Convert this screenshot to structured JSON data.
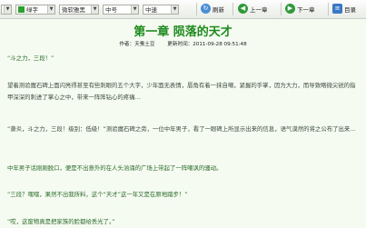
{
  "toolbar": {
    "color_label": "绿字",
    "color_hex": "#2ea02e",
    "font_label": "微软雅黑",
    "size_label": "中号",
    "speed_label": "中速",
    "refresh_label": "刷新",
    "prev_label": "上一章",
    "next_label": "下一章",
    "toc_label": "目录"
  },
  "chapter": {
    "title": "第一章  陨落的天才",
    "author": "作者：天蚕土豆",
    "updated": "更新时间：2011-09-28 09:51:48"
  },
  "paragraphs": [
    "“斗之力，三段！”",
    "望着测验魔石碑上面闪亮得甚至有些刺眼的五个大字，少年面无表情，唇角有着一抹自嘲，紧握的手掌，因为大力，而导致略微尖锐的指甲深深的刺进了掌心之中，带来一阵阵钻心的疼痛…",
    "“萧炎，斗之力，三段！级别：低级！”测验魔石碑之旁，一位中年男子，看了一眼碑上所显示出来的信息，语气漠然的将之公布了出来…",
    "中年男子话刚刚脱口，便是不出意外的在人头汹涌的广场上带起了一阵嘲讽的骚动。",
    "“三段？嘿嘿，果然不出我所料，这个“天才”这一年又是在原地踏步！”",
    "“哎，这废物真是把家族的脸都给丢光了。”"
  ]
}
